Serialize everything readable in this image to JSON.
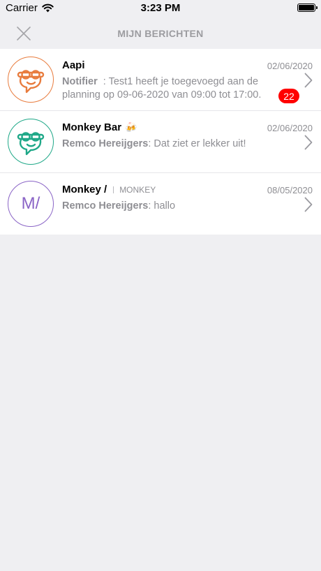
{
  "status_bar": {
    "carrier": "Carrier",
    "time": "3:23 PM"
  },
  "header": {
    "title": "MIJN BERICHTEN",
    "close_icon": "close-icon"
  },
  "colors": {
    "orange": "#e87c3e",
    "green": "#1fa888",
    "purple": "#8a64c6",
    "badge": "#ff0000"
  },
  "conversations": [
    {
      "title": "Aapi",
      "date": "02/06/2020",
      "sender": "Notifier",
      "separator": "  : ",
      "message": "Test1 heeft je toegevoegd aan de planning op 09-06-2020 van 09:00 tot 17:00.",
      "badge": "22",
      "avatar_icon": "monkey-icon"
    },
    {
      "title": "Monkey Bar",
      "emoji": "🍻",
      "date": "02/06/2020",
      "sender": "Remco Hereijgers",
      "separator": ": ",
      "message": "Dat ziet er lekker uit!",
      "avatar_icon": "monkey-icon"
    },
    {
      "title": "Monkey /",
      "subtag": "MONKEY",
      "date": "08/05/2020",
      "sender": "Remco Hereijgers",
      "separator": ": ",
      "message": "hallo",
      "avatar_initials": "M/"
    }
  ]
}
